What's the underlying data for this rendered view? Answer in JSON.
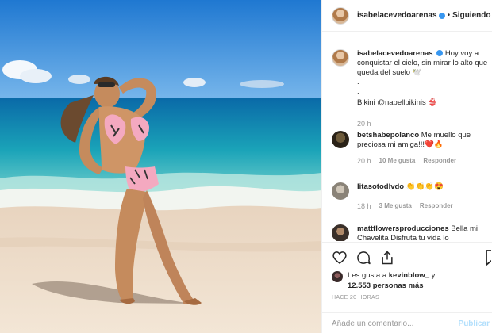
{
  "post": {
    "username": "isabelacevedoarenas",
    "follow_status": "Siguiendo",
    "separator": "•"
  },
  "caption": {
    "username": "isabelacevedoarenas",
    "text": "Hoy voy a conquistar el cielo, sin mirar lo alto que queda del suelo 🕊️",
    "dot1": ".",
    "dot2": ".",
    "credit": "Bikini @nabellbikinis 👙",
    "time": "20 h"
  },
  "comments": [
    {
      "username": "betshabepolanco",
      "text": "Me muello que preciosa mi amiga!!!❤️🔥",
      "time": "20 h",
      "likes": "10 Me gusta",
      "reply": "Responder"
    },
    {
      "username": "litasotodlvdo",
      "text": "👏👏👏😍",
      "time": "18 h",
      "likes": "3 Me gusta",
      "reply": "Responder"
    },
    {
      "username": "mattflowersproducciones",
      "text": "Bella mi Chavelita Disfruta tu vida lo"
    }
  ],
  "likes": {
    "prefix": "Les gusta a",
    "user": "kevinblow_",
    "and": "y",
    "count": "12.553 personas más"
  },
  "posted_time": "HACE 20 HORAS",
  "comment_input": {
    "placeholder": "Añade un comentario...",
    "publish": "Publicar"
  },
  "icons": {
    "like": "heart-icon",
    "comment": "comment-icon",
    "share": "share-icon",
    "save": "bookmark-icon",
    "comment_like": "heart-small-icon"
  },
  "colors": {
    "accent": "#3897f0",
    "secondary_text": "#999999",
    "publish_disabled": "#b2dffc"
  }
}
